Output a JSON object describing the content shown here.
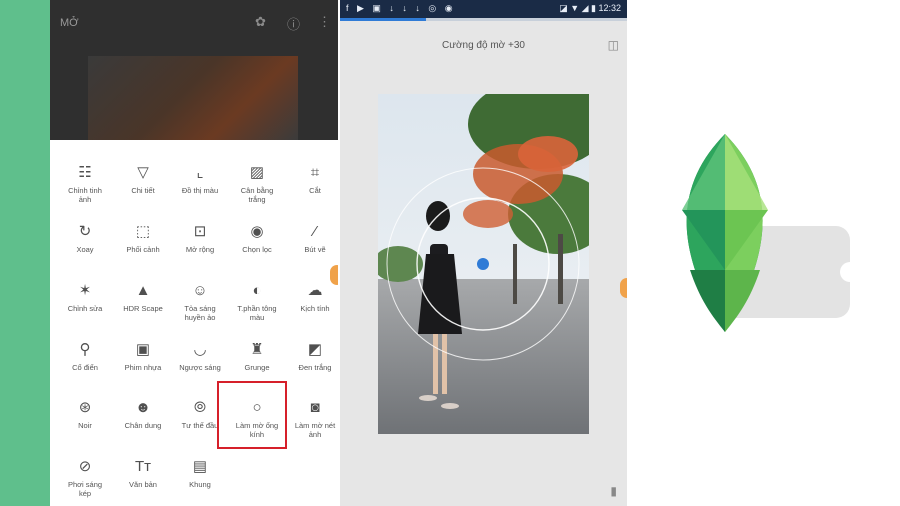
{
  "left_screen": {
    "app_title": "MỞ",
    "tools": [
      {
        "label": "Chỉnh tinh\nảnh",
        "icon": "tune-icon"
      },
      {
        "label": "Chi tiết",
        "icon": "details-icon"
      },
      {
        "label": "Đồ thị màu",
        "icon": "curves-icon"
      },
      {
        "label": "Cân bằng\ntrắng",
        "icon": "white-balance-icon"
      },
      {
        "label": "Cắt",
        "icon": "crop-icon"
      },
      {
        "label": "Xoay",
        "icon": "rotate-icon"
      },
      {
        "label": "Phối cảnh",
        "icon": "perspective-icon"
      },
      {
        "label": "Mở rộng",
        "icon": "expand-icon"
      },
      {
        "label": "Chọn lọc",
        "icon": "selective-icon"
      },
      {
        "label": "Bút vẽ",
        "icon": "brush-icon"
      },
      {
        "label": "Chỉnh sửa",
        "icon": "healing-icon"
      },
      {
        "label": "HDR Scape",
        "icon": "hdr-icon"
      },
      {
        "label": "Tỏa sáng\nhuyền ảo",
        "icon": "glamour-glow-icon"
      },
      {
        "label": "T.phần tông\nmàu",
        "icon": "tonal-contrast-icon"
      },
      {
        "label": "Kịch tính",
        "icon": "drama-icon"
      },
      {
        "label": "Cổ điển",
        "icon": "vintage-icon"
      },
      {
        "label": "Phim nhựa",
        "icon": "grainy-film-icon"
      },
      {
        "label": "Ngược sáng",
        "icon": "retrolux-icon"
      },
      {
        "label": "Grunge",
        "icon": "grunge-icon"
      },
      {
        "label": "Đen trắng",
        "icon": "black-white-icon"
      },
      {
        "label": "Noir",
        "icon": "noir-icon"
      },
      {
        "label": "Chân dung",
        "icon": "portrait-icon"
      },
      {
        "label": "Tư thế đầu",
        "icon": "head-pose-icon"
      },
      {
        "label": "Làm mờ ống\nkính",
        "icon": "lens-blur-icon"
      },
      {
        "label": "Làm mờ nét\nảnh",
        "icon": "vignette-icon"
      },
      {
        "label": "Phơi sáng\nkép",
        "icon": "double-exposure-icon"
      },
      {
        "label": "Văn bản",
        "icon": "text-icon"
      },
      {
        "label": "Khung",
        "icon": "frames-icon"
      }
    ],
    "icon_glyphs": [
      "☷",
      "▽",
      "⌞",
      "▨",
      "⌗",
      "↻",
      "⬚",
      "⊡",
      "◉",
      "⁄",
      "✶",
      "▲",
      "☺",
      "◐",
      "☁",
      "⚲",
      "▣",
      "◡",
      "♜",
      "◩",
      "⊛",
      "☻",
      "⦾",
      "○",
      "◙",
      "⊘",
      "Tт",
      "▤"
    ]
  },
  "right_screen": {
    "status_left": "f ▶ ▣ ↓ ↓ ↓ ◎ ◉",
    "status_right": "◪ ▼ ◢ ▮ 12:32",
    "title": "Cường độ mờ +30",
    "progress_fraction": 0.3
  },
  "colors": {
    "strip_green": "#5fbf8c",
    "highlight_red": "#d6202a",
    "status_bar": "#1a2b46",
    "accent_blue": "#2f7bd6"
  }
}
